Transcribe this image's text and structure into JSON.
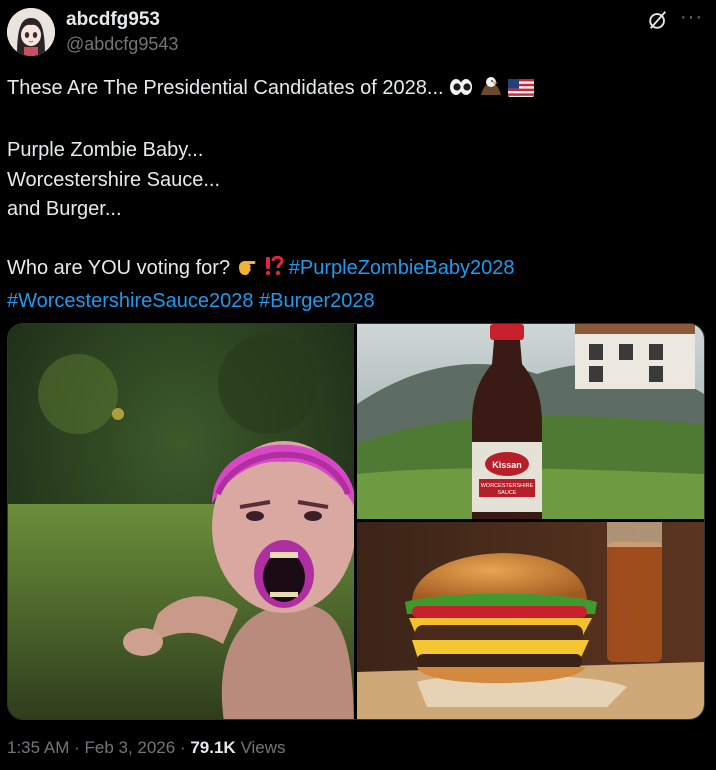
{
  "author": {
    "display_name": "abcdfg953",
    "handle": "@abdcfg9543"
  },
  "tweet": {
    "line1_text": "These Are The Presidential Candidates of 2028...",
    "line1_emojis": [
      "eyes-emoji",
      "eagle-emoji",
      "us-flag-emoji"
    ],
    "line2": "Purple Zombie Baby...",
    "line3": "Worcestershire Sauce...",
    "line4": "and Burger...",
    "line5_text": "Who are YOU voting for?",
    "line5_emojis": [
      "pointing-hand-emoji",
      "interrobang-emoji"
    ],
    "hashtags": [
      "#PurpleZombieBaby2028",
      "#WorcestershireSauce2028",
      "#Burger2028"
    ]
  },
  "media": {
    "sauce_label": "Kissan\nWORCESTERSHIRE\nSAUCE"
  },
  "meta": {
    "time": "1:35 AM",
    "separator": " · ",
    "date": "Feb 3, 2026",
    "views_count": "79.1K",
    "views_label": "Views"
  },
  "colors": {
    "background": "#000000",
    "text": "#e7e9ea",
    "secondary": "#71767b",
    "hashtag": "#1d9bf0"
  }
}
